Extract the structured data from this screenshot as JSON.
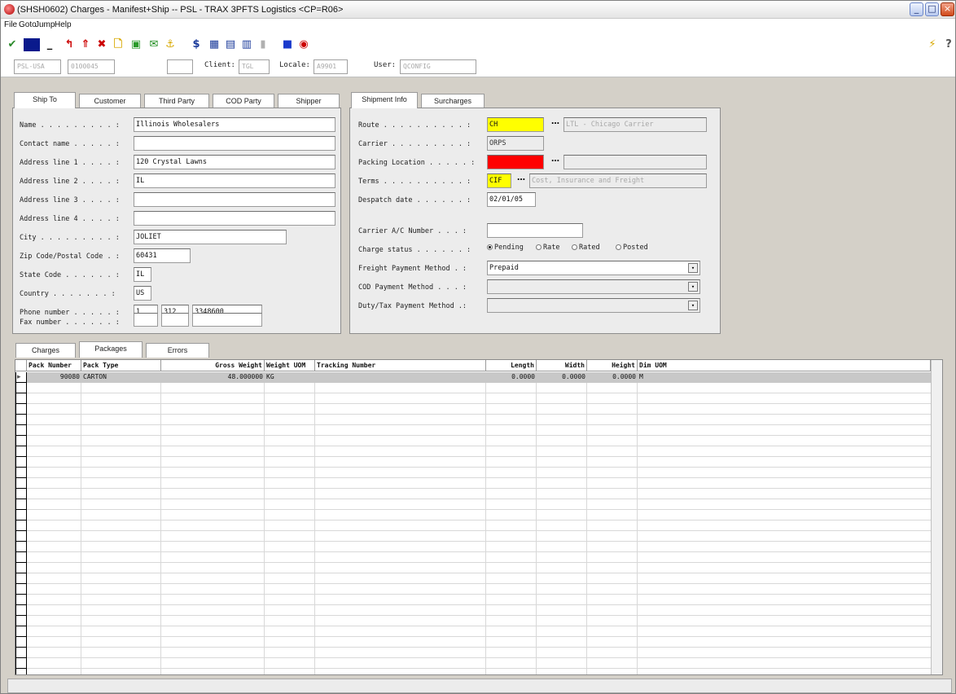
{
  "window": {
    "title": "(SHSH0602) Charges - Manifest+Ship -- PSL - TRAX 3PFTS Logistics <CP=R06>"
  },
  "menu": [
    "File",
    "Goto",
    "Jump",
    "Help"
  ],
  "toolbar_icons": [
    "check-icon",
    "save-icon",
    "minimize-form-icon",
    "undo-icon",
    "up-arrow-icon",
    "delete-icon",
    "new-document-icon",
    "drawer-icon",
    "mail-icon",
    "ship-icon",
    "pricing-icon",
    "calculator-icon",
    "printer-icon",
    "report-icon",
    "disabled-icon",
    "info-icon",
    "zoom-icon",
    "lightning-icon",
    "help-icon"
  ],
  "context": {
    "company": "PSL-USA",
    "order": "0100045",
    "blank": "",
    "client_label": "Client:",
    "client_value": "TGL",
    "locale_label": "Locale:",
    "locale_value": "A9901",
    "user_label": "User:",
    "user_value": "QCONFIG"
  },
  "left_tabs": [
    "Ship To",
    "Customer",
    "Third Party",
    "COD Party",
    "Shipper"
  ],
  "address": {
    "name_label": "Name . . . . . . . . . :",
    "name": "Illinois Wholesalers",
    "contact_label": "Contact name . . . . . :",
    "contact": "",
    "addr1_label": "Address line 1 . . . . :",
    "addr1": "120 Crystal Lawns",
    "addr2_label": "Address line 2 . . . . :",
    "addr2": "IL",
    "addr3_label": "Address line 3 . . . . :",
    "addr3": "",
    "addr4_label": "Address line 4 . . . . :",
    "addr4": "",
    "city_label": "City . . . . . . . . . :",
    "city": "JOLIET",
    "zip_label": "Zip Code/Postal Code . :",
    "zip": "60431",
    "state_label": "State Code . . . . . . :",
    "state": "IL",
    "country_label": "Country . . . . . . . :",
    "country": "US",
    "phone_label": "Phone number . . . . . :",
    "phone_1": "1",
    "phone_2": "312",
    "phone_3": "3348600",
    "fax_label": "Fax number . . . . . . :",
    "fax_1": "",
    "fax_2": "",
    "fax_3": ""
  },
  "right_tabs": [
    "Shipment Info",
    "Surcharges"
  ],
  "shipment": {
    "route_label": "Route . . . . . . . . . . :",
    "route": "CH",
    "route_desc": "LTL - Chicago Carrier",
    "carrier_label": "Carrier . . . . . . . . . :",
    "carrier": "ORPS",
    "packloc_label": "Packing Location . . . . . :",
    "packloc": "",
    "packloc_desc": "",
    "terms_label": "Terms . . . . . . . . . . :",
    "terms": "CIF",
    "terms_desc": "Cost, Insurance and Freight",
    "despatch_label": "Despatch date . . . . . . :",
    "despatch": "02/01/05",
    "carrier_ac_label": "Carrier A/C Number . . . :",
    "carrier_ac": "",
    "charge_status_label": "Charge status . . . . . . :",
    "charge_status_options": [
      "Pending",
      "Rate",
      "Rated",
      "Posted"
    ],
    "freight_label": "Freight Payment Method . :",
    "freight": "Prepaid",
    "cod_label": "COD Payment Method . . . :",
    "cod": "",
    "duty_label": "Duty/Tax Payment Method .:",
    "duty": ""
  },
  "bottom_tabs": [
    "Charges",
    "Packages",
    "Errors"
  ],
  "grid": {
    "headers": [
      "Pack Number",
      "Pack Type",
      "Gross Weight",
      "Weight UOM",
      "Tracking Number",
      "Length",
      "Width",
      "Height",
      "Dim UOM"
    ],
    "rows": [
      [
        "90080",
        "CARTON",
        "48.000000",
        "KG",
        "",
        "0.0000",
        "0.0000",
        "0.0000",
        "M"
      ]
    ]
  },
  "colors": {
    "accent_yellow": "#ffff00",
    "required_red": "#ff0000",
    "selected_row": "#c8c8c8"
  }
}
